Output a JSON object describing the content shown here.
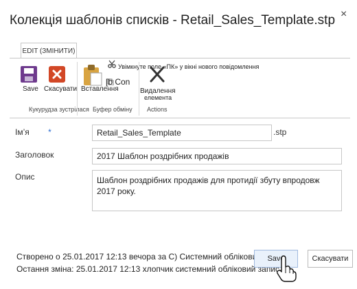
{
  "dialog": {
    "title": "Колекція шаблонів списків - Retail_Sales_Template.stp",
    "close_glyph": "×"
  },
  "ribbon": {
    "tab_label": "EDIT (ЗМІНИТИ)",
    "commit_group": {
      "save_label": "Save",
      "cancel_label": "Скасувати",
      "group_label": "Кукурудза зустрілася"
    },
    "clipboard_group": {
      "paste_label": "Вставлення",
      "cut_label": "Увімкнуте поле «ПК» у вікні нового повідомлення",
      "copy_label": "[b Con",
      "group_label": "Буфер обміну"
    },
    "actions_group": {
      "delete_label_line1": "Видалення",
      "delete_label_line2": "елемента",
      "group_label": "Actions"
    }
  },
  "form": {
    "name_label": "Ім’я",
    "name_required_marker": "*",
    "name_value": "Retail_Sales_Template",
    "name_suffix": ".stp",
    "title_label": "Заголовок",
    "title_value": "2017 Шаблон роздрібних продажів",
    "description_label": "Опис",
    "description_value": "Шаблон роздрібних продажів для протидії збуту впродовж 2017 року."
  },
  "footer": {
    "created_text": "Створено о 25.01.2017 12:13 вечора за С) Системний обліковий запис",
    "modified_text": "Остання зміна: 25.01.2017 12:13 хлопчик системний обліковий запис",
    "save_button_label": "Save",
    "cancel_button_label": "Скасувати"
  },
  "colors": {
    "save_icon": "#6e3a8d",
    "cancel_icon": "#d24726",
    "paste_icon": "#d9a441",
    "required_marker": "#2a6bd1"
  }
}
